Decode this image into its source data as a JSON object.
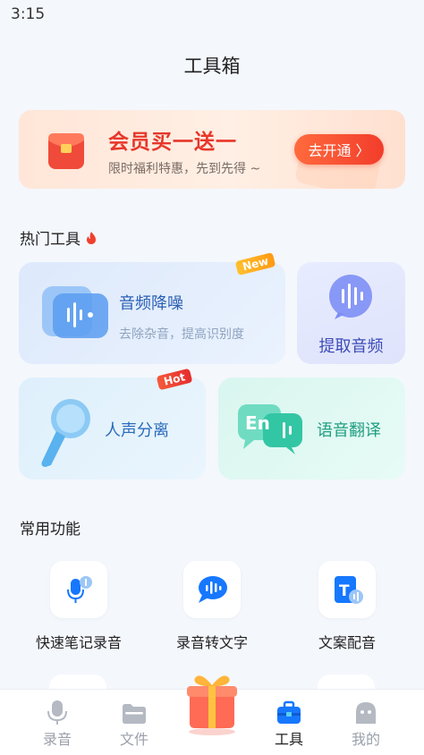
{
  "status_bar": {
    "time": "3:15"
  },
  "header": {
    "title": "工具箱"
  },
  "banner": {
    "title": "会员买一送一",
    "subtitle": "限时福利特惠，先到先得 ~",
    "button": "去开通 〉"
  },
  "hot_tools": {
    "heading": "热门工具",
    "items": [
      {
        "label": "音频降噪",
        "desc": "去除杂音，提高识别度",
        "tag": "New"
      },
      {
        "label": "提取音频"
      },
      {
        "label": "人声分离",
        "tag": "Hot"
      },
      {
        "label": "语音翻译"
      }
    ]
  },
  "common": {
    "heading": "常用功能",
    "items": [
      {
        "label": "快速笔记录音"
      },
      {
        "label": "录音转文字"
      },
      {
        "label": "文案配音"
      }
    ]
  },
  "tabbar": {
    "items": [
      {
        "label": "录音"
      },
      {
        "label": "文件"
      },
      {
        "label": "工具"
      },
      {
        "label": "我的"
      }
    ],
    "active": "工具"
  },
  "colors": {
    "accent": "#1677ff",
    "promo": "#f23d2b",
    "hot_tag": "#f23d2b",
    "new_tag": "#ffa91a"
  }
}
